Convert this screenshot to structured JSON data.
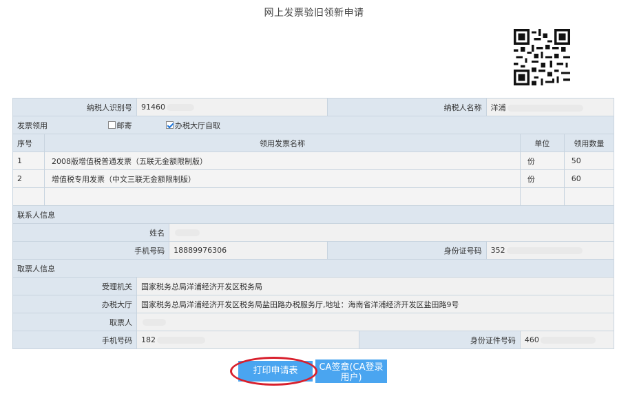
{
  "page": {
    "title": "网上发票验旧领新申请"
  },
  "taxpayer": {
    "id_label": "纳税人识别号",
    "id_value": "91460",
    "name_label": "纳税人名称",
    "name_value": "洋浦"
  },
  "invoice_pickup": {
    "label": "发票领用",
    "options": [
      {
        "label": "邮寄",
        "checked": false
      },
      {
        "label": "办税大厅自取",
        "checked": true
      }
    ]
  },
  "invoice_table": {
    "headers": [
      "序号",
      "领用发票名称",
      "单位",
      "领用数量"
    ],
    "rows": [
      {
        "no": "1",
        "name": "2008版增值税普通发票（五联无金额限制版）",
        "unit": "份",
        "qty": "50"
      },
      {
        "no": "2",
        "name": "增值税专用发票（中文三联无金额限制版）",
        "unit": "份",
        "qty": "60"
      }
    ]
  },
  "contact": {
    "section_label": "联系人信息",
    "name_label": "姓名",
    "name_value": "",
    "phone_label": "手机号码",
    "phone_value": "18889976306",
    "idcard_label": "身份证号码",
    "idcard_value": "352"
  },
  "receiver": {
    "section_label": "取票人信息",
    "authority_label": "受理机关",
    "authority_value": "国家税务总局洋浦经济开发区税务局",
    "hall_label": "办税大厅",
    "hall_value": "国家税务总局洋浦经济开发区税务局盐田路办税服务厅,地址：海南省洋浦经济开发区盐田路9号",
    "person_label": "取票人",
    "person_value": "",
    "phone_label": "手机号码",
    "phone_value": "182",
    "idcard_label": "身份证件号码",
    "idcard_value": "460"
  },
  "buttons": {
    "print_label": "打印申请表",
    "ca_label": "CA签章(CA登录用户)"
  },
  "colors": {
    "accent": "#4aa5f0",
    "highlight_ring": "#d8202d",
    "label_bg": "#dde6ef"
  },
  "icons": [
    "qr-code-icon"
  ]
}
